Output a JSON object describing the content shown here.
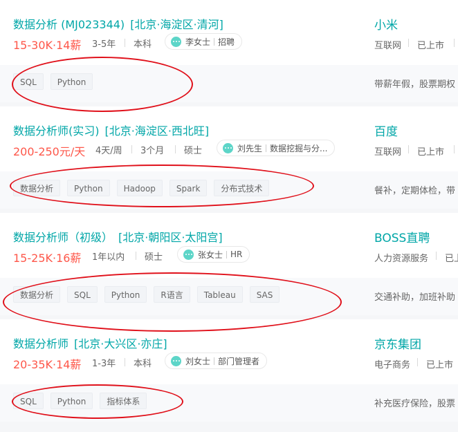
{
  "jobs": [
    {
      "title": "数据分析 (MJ023344)",
      "location": "[北京·海淀区·清河]",
      "salary": "15-30K·14薪",
      "experience": "3-5年",
      "education": "本科",
      "contact_name": "李女士",
      "contact_role": "招聘",
      "company": "小米",
      "industry": "互联网",
      "stage": "已上市",
      "tags": [
        "SQL",
        "Python"
      ],
      "benefits": "带薪年假，股票期权"
    },
    {
      "title": "数据分析师(实习)",
      "location": "[北京·海淀区·西北旺]",
      "salary": "200-250元/天",
      "experience": "4天/周",
      "duration": "3个月",
      "education": "硕士",
      "contact_name": "刘先生",
      "contact_role": "数据挖掘与分...",
      "company": "百度",
      "industry": "互联网",
      "stage": "已上市",
      "tags": [
        "数据分析",
        "Python",
        "Hadoop",
        "Spark",
        "分布式技术"
      ],
      "benefits": "餐补，定期体检，带"
    },
    {
      "title": "数据分析师（初级）",
      "location": "[北京·朝阳区·太阳宫]",
      "salary": "15-25K·16薪",
      "experience": "1年以内",
      "education": "硕士",
      "contact_name": "张女士",
      "contact_role": "HR",
      "company": "BOSS直聘",
      "industry": "人力资源服务",
      "stage": "已上",
      "tags": [
        "数据分析",
        "SQL",
        "Python",
        "R语言",
        "Tableau",
        "SAS"
      ],
      "benefits": "交通补助，加班补助"
    },
    {
      "title": "数据分析师",
      "location": "[北京·大兴区·亦庄]",
      "salary": "20-35K·14薪",
      "experience": "1-3年",
      "education": "本科",
      "contact_name": "刘女士",
      "contact_role": "部门管理者",
      "company": "京东集团",
      "industry": "电子商务",
      "stage": "已上市",
      "tags": [
        "SQL",
        "Python",
        "指标体系"
      ],
      "benefits": "补充医疗保险，股票"
    }
  ],
  "colors": {
    "title": "#00a6a7",
    "salary": "#fe574a",
    "annotation_circle": "#e0101a",
    "chat_icon": "#5dd5c8"
  },
  "icons": {
    "contact": "chat-bubble-icon"
  }
}
